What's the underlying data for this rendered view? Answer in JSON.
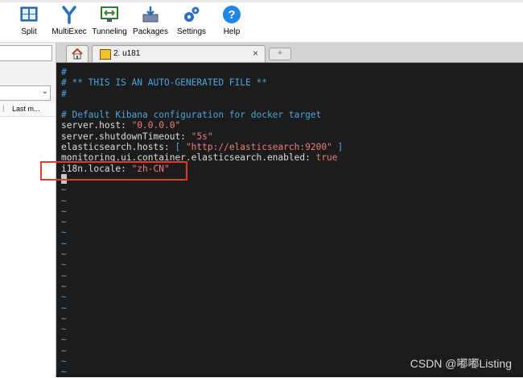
{
  "toolbar": {
    "items": [
      {
        "label": "Split",
        "icon": "split-grid-icon"
      },
      {
        "label": "MultiExec",
        "icon": "multiexec-fork-icon"
      },
      {
        "label": "Tunneling",
        "icon": "tunneling-icon"
      },
      {
        "label": "Packages",
        "icon": "packages-download-icon"
      },
      {
        "label": "Settings",
        "icon": "settings-gears-icon"
      },
      {
        "label": "Help",
        "icon": "help-question-icon"
      }
    ]
  },
  "sidebar": {
    "column_header": "Last m..."
  },
  "tabs": {
    "home_icon": "home-icon",
    "active": {
      "title": "2. u181",
      "close": "×"
    },
    "new_tab": "+"
  },
  "terminal": {
    "lines": [
      [
        {
          "t": "#",
          "c": "comment"
        }
      ],
      [
        {
          "t": "# ** THIS IS AN AUTO-GENERATED FILE **",
          "c": "comment"
        }
      ],
      [
        {
          "t": "#",
          "c": "comment"
        }
      ],
      [
        {
          "t": "",
          "c": "key"
        }
      ],
      [
        {
          "t": "# Default Kibana configuration for docker target",
          "c": "comment"
        }
      ],
      [
        {
          "t": "server.host: ",
          "c": "key"
        },
        {
          "t": "\"0.0.0.0\"",
          "c": "str"
        }
      ],
      [
        {
          "t": "server.shutdownTimeout: ",
          "c": "key"
        },
        {
          "t": "\"5s\"",
          "c": "str"
        }
      ],
      [
        {
          "t": "elasticsearch.hosts: ",
          "c": "key"
        },
        {
          "t": "[ ",
          "c": "br"
        },
        {
          "t": "\"http://elasticsearch:9200\"",
          "c": "str"
        },
        {
          "t": " ]",
          "c": "br"
        }
      ],
      [
        {
          "t": "monitoring.ui.container.elasticsearch.enabled: ",
          "c": "key"
        },
        {
          "t": "true",
          "c": "bool"
        }
      ],
      [
        {
          "t": "i18n.locale: ",
          "c": "key"
        },
        {
          "t": "\"zh-CN\"",
          "c": "str"
        }
      ]
    ],
    "tilde": "~",
    "tilde_count": 18
  },
  "watermark": "CSDN @嘟嘟Listing",
  "colors": {
    "terminal_bg": "#1c1c1c",
    "comment": "#4aa3df",
    "string": "#ef7b7b",
    "highlight_box": "#e23a2b"
  }
}
